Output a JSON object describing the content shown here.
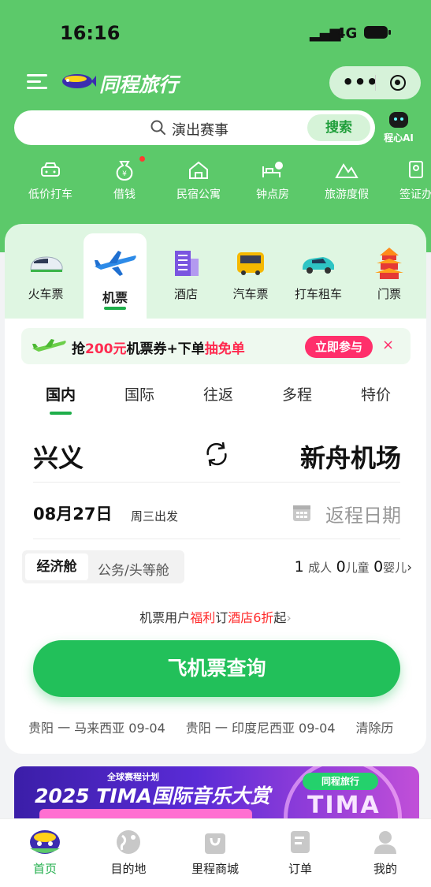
{
  "status_bar": {
    "time": "16:16",
    "signal": "▂▄▆",
    "network": "4G"
  },
  "header": {
    "brand": "同程旅行",
    "capsule_more": "•••"
  },
  "search": {
    "placeholder": "演出赛事",
    "button": "搜索",
    "ai_label": "程心AI"
  },
  "services": [
    {
      "label": "低价打车",
      "icon": "car-icon"
    },
    {
      "label": "借钱",
      "icon": "money-bag-icon"
    },
    {
      "label": "民宿公寓",
      "icon": "house-icon"
    },
    {
      "label": "钟点房",
      "icon": "bed-clock-icon"
    },
    {
      "label": "旅游度假",
      "icon": "mountain-icon"
    },
    {
      "label": "签证办",
      "icon": "visa-icon"
    }
  ],
  "categories": [
    {
      "label": "火车票",
      "icon": "train-icon"
    },
    {
      "label": "机票",
      "icon": "airplane-icon",
      "active": true
    },
    {
      "label": "酒店",
      "icon": "hotel-icon"
    },
    {
      "label": "汽车票",
      "icon": "bus-icon"
    },
    {
      "label": "打车租车",
      "icon": "taxi-icon"
    },
    {
      "label": "门票",
      "icon": "pagoda-icon"
    }
  ],
  "promo": {
    "prefix": "抢",
    "amount": "200元",
    "middle": "机票券+下单",
    "highlight": "抽免单",
    "button": "立即参与",
    "close": "×"
  },
  "trip_tabs": [
    "国内",
    "国际",
    "往返",
    "多程",
    "特价"
  ],
  "route": {
    "from": "兴义",
    "to": "新舟机场"
  },
  "date": {
    "depart": "08月27日",
    "weekday": "周三出发",
    "return_placeholder": "返程日期"
  },
  "cabin": {
    "economy": "经济舱",
    "business": "公务/头等舱"
  },
  "passengers": {
    "adults": "1",
    "adults_label": "成人",
    "children": "0",
    "children_label": "儿童",
    "infants": "0",
    "infants_label": "婴儿",
    "chevron": "›"
  },
  "hotel_promo": {
    "p1": "机票用户",
    "p2": "福利",
    "p3": "订",
    "p4": "酒店6折",
    "p5": "起",
    "chev": "›"
  },
  "search_button": "飞机票查询",
  "history": [
    "贵阳 一 马来西亚 09-04",
    "贵阳 一 印度尼西亚 09-04",
    "清除历"
  ],
  "banner": {
    "small": "全球赛程计划",
    "big": "2025 TIMA国际音乐大赏",
    "tag": "同程旅行",
    "tima": "TIMA"
  },
  "bottom_nav": [
    {
      "label": "首页",
      "icon": "home-mascot-icon",
      "active": true
    },
    {
      "label": "目的地",
      "icon": "globe-icon"
    },
    {
      "label": "里程商城",
      "icon": "shopping-bag-icon"
    },
    {
      "label": "订单",
      "icon": "order-icon"
    },
    {
      "label": "我的",
      "icon": "profile-icon"
    }
  ],
  "colors": {
    "brand_green": "#5cc96a",
    "accent_green": "#22c05a",
    "promo_red": "#ff2a4f"
  }
}
